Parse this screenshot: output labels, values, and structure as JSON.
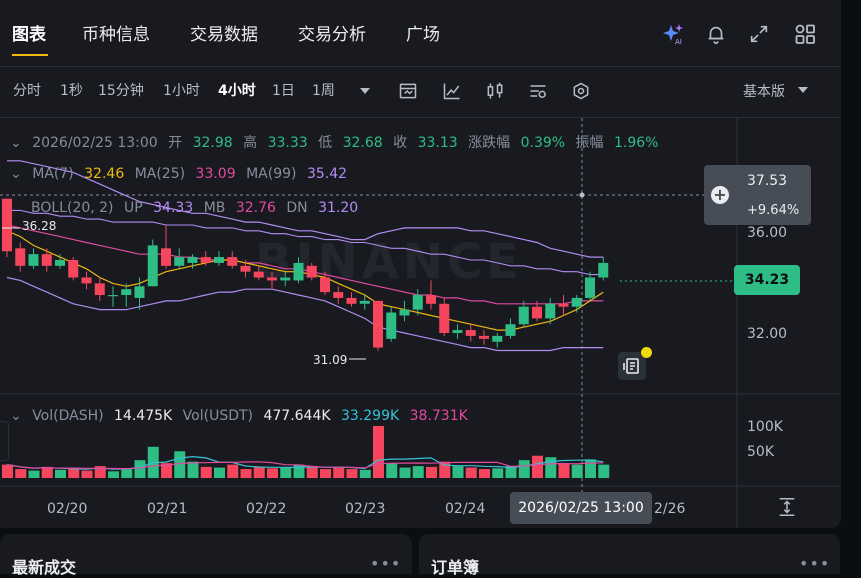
{
  "tabs": [
    {
      "label": "图表",
      "active": true
    },
    {
      "label": "币种信息"
    },
    {
      "label": "交易数据"
    },
    {
      "label": "交易分析"
    },
    {
      "label": "广场"
    }
  ],
  "top_icons": [
    "ai-sparkle-icon",
    "bell-icon",
    "expand-icon",
    "grid-icon"
  ],
  "intervals": [
    {
      "label": "分时"
    },
    {
      "label": "1秒"
    },
    {
      "label": "15分钟"
    },
    {
      "label": "1小时"
    },
    {
      "label": "4小时",
      "active": true
    },
    {
      "label": "1日"
    },
    {
      "label": "1周"
    }
  ],
  "toolbar_icons": [
    "caret-down-icon",
    "indicator-icon",
    "line-tool-icon",
    "candle-type-icon",
    "settings-icon",
    "depth-icon"
  ],
  "version_label": "基本版",
  "ohlc": {
    "date": "2026/02/25 13:00",
    "open_label": "开",
    "open": "32.98",
    "high_label": "高",
    "high": "33.33",
    "low_label": "低",
    "low": "32.68",
    "close_label": "收",
    "close": "33.13",
    "change_label": "涨跌幅",
    "change": "0.39%",
    "amp_label": "振幅",
    "amp": "1.96%"
  },
  "ma": {
    "ma7_label": "MA(7)",
    "ma7": "32.46",
    "ma25_label": "MA(25)",
    "ma25": "33.09",
    "ma99_label": "MA(99)",
    "ma99": "35.42"
  },
  "boll": {
    "label": "BOLL(20, 2)",
    "up_label": "UP",
    "up": "34.33",
    "mb_label": "MB",
    "mb": "32.76",
    "dn_label": "DN",
    "dn": "31.20"
  },
  "volume": {
    "label1": "Vol(DASH)",
    "v1": "14.475K",
    "label2": "Vol(USDT)",
    "v2": "477.644K",
    "ma1": "33.299K",
    "ma2": "38.731K"
  },
  "crosshair": {
    "price": "37.53",
    "change": "+9.64%",
    "time": "2026/02/25 13:00"
  },
  "last_price": "34.23",
  "price_axis": [
    "36.00",
    "32.00"
  ],
  "volume_axis": [
    "100K",
    "50K"
  ],
  "x_axis": [
    "02/20",
    "02/21",
    "02/22",
    "02/23",
    "02/24",
    "2/26"
  ],
  "annotations": {
    "high": "36.28",
    "low": "31.09"
  },
  "watermark": "BINANCE",
  "bottom_cards": [
    {
      "title": "最新成交"
    },
    {
      "title": "订单簿"
    }
  ],
  "colors": {
    "up": "#2ebd85",
    "down": "#f6465d",
    "ma7": "#f0b90b",
    "ma25": "#e04aa0",
    "ma99": "#b18cf2",
    "accent": "#f0b90b"
  },
  "chart_data": {
    "type": "candlestick",
    "price_range": [
      30.5,
      37.9
    ],
    "candles": [
      {
        "o": 36.3,
        "c": 34.5,
        "h": 36.3,
        "l": 34.3
      },
      {
        "o": 34.6,
        "c": 34.0,
        "h": 34.8,
        "l": 33.8
      },
      {
        "o": 34.0,
        "c": 34.4,
        "h": 34.6,
        "l": 33.9
      },
      {
        "o": 34.4,
        "c": 34.0,
        "h": 34.6,
        "l": 33.8
      },
      {
        "o": 34.0,
        "c": 34.2,
        "h": 34.4,
        "l": 33.9
      },
      {
        "o": 34.2,
        "c": 33.6,
        "h": 34.3,
        "l": 33.5
      },
      {
        "o": 33.6,
        "c": 33.4,
        "h": 33.8,
        "l": 33.2
      },
      {
        "o": 33.4,
        "c": 33.0,
        "h": 33.6,
        "l": 32.8
      },
      {
        "o": 33.0,
        "c": 33.0,
        "h": 33.3,
        "l": 32.6
      },
      {
        "o": 33.0,
        "c": 33.2,
        "h": 33.4,
        "l": 32.6
      },
      {
        "o": 32.9,
        "c": 33.3,
        "h": 33.6,
        "l": 32.5
      },
      {
        "o": 33.3,
        "c": 34.7,
        "h": 34.9,
        "l": 33.3
      },
      {
        "o": 34.6,
        "c": 34.0,
        "h": 35.4,
        "l": 33.9
      },
      {
        "o": 34.0,
        "c": 34.3,
        "h": 34.6,
        "l": 33.9
      },
      {
        "o": 34.1,
        "c": 34.3,
        "h": 34.4,
        "l": 33.9
      },
      {
        "o": 34.3,
        "c": 34.1,
        "h": 34.5,
        "l": 34.0
      },
      {
        "o": 34.1,
        "c": 34.3,
        "h": 34.5,
        "l": 34.0
      },
      {
        "o": 34.3,
        "c": 34.0,
        "h": 34.5,
        "l": 33.9
      },
      {
        "o": 34.0,
        "c": 33.8,
        "h": 34.2,
        "l": 33.6
      },
      {
        "o": 33.8,
        "c": 33.6,
        "h": 34.0,
        "l": 33.5
      },
      {
        "o": 33.6,
        "c": 33.5,
        "h": 33.8,
        "l": 33.2
      },
      {
        "o": 33.5,
        "c": 33.6,
        "h": 33.8,
        "l": 33.3
      },
      {
        "o": 33.5,
        "c": 34.1,
        "h": 34.3,
        "l": 33.4
      },
      {
        "o": 34.0,
        "c": 33.6,
        "h": 34.1,
        "l": 33.5
      },
      {
        "o": 33.6,
        "c": 33.1,
        "h": 33.8,
        "l": 33.0
      },
      {
        "o": 33.1,
        "c": 32.9,
        "h": 33.3,
        "l": 32.7
      },
      {
        "o": 32.9,
        "c": 32.7,
        "h": 33.1,
        "l": 32.6
      },
      {
        "o": 32.7,
        "c": 32.8,
        "h": 33.0,
        "l": 32.5
      },
      {
        "o": 32.8,
        "c": 31.2,
        "h": 32.8,
        "l": 31.1
      },
      {
        "o": 31.5,
        "c": 32.4,
        "h": 32.6,
        "l": 31.4
      },
      {
        "o": 32.3,
        "c": 32.5,
        "h": 32.8,
        "l": 32.1
      },
      {
        "o": 32.5,
        "c": 33.0,
        "h": 33.2,
        "l": 32.3
      },
      {
        "o": 33.0,
        "c": 32.7,
        "h": 33.5,
        "l": 32.5
      },
      {
        "o": 32.7,
        "c": 31.7,
        "h": 32.9,
        "l": 31.6
      },
      {
        "o": 31.7,
        "c": 31.8,
        "h": 32.0,
        "l": 31.5
      },
      {
        "o": 31.8,
        "c": 31.6,
        "h": 32.0,
        "l": 31.4
      },
      {
        "o": 31.6,
        "c": 31.5,
        "h": 31.8,
        "l": 31.3
      },
      {
        "o": 31.4,
        "c": 31.6,
        "h": 31.7,
        "l": 31.2
      },
      {
        "o": 31.6,
        "c": 32.0,
        "h": 32.2,
        "l": 31.5
      },
      {
        "o": 32.0,
        "c": 32.6,
        "h": 32.8,
        "l": 31.9
      },
      {
        "o": 32.6,
        "c": 32.2,
        "h": 32.8,
        "l": 32.1
      },
      {
        "o": 32.2,
        "c": 32.7,
        "h": 32.9,
        "l": 32.0
      },
      {
        "o": 32.7,
        "c": 32.6,
        "h": 33.0,
        "l": 32.3
      },
      {
        "o": 32.6,
        "c": 32.9,
        "h": 33.0,
        "l": 32.4
      },
      {
        "o": 32.9,
        "c": 33.6,
        "h": 33.8,
        "l": 32.8
      },
      {
        "o": 33.6,
        "c": 34.1,
        "h": 34.3,
        "l": 33.5
      }
    ],
    "volumes": [
      18,
      12,
      10,
      15,
      11,
      14,
      10,
      16,
      9,
      12,
      24,
      42,
      20,
      36,
      22,
      15,
      14,
      18,
      12,
      15,
      13,
      14,
      18,
      15,
      12,
      14,
      12,
      11,
      70,
      20,
      14,
      16,
      15,
      22,
      16,
      14,
      12,
      13,
      16,
      24,
      30,
      28,
      20,
      18,
      25,
      18
    ],
    "ma7": [
      35.2,
      35.0,
      34.7,
      34.5,
      34.3,
      34.1,
      33.9,
      33.6,
      33.4,
      33.3,
      33.4,
      33.6,
      33.8,
      33.9,
      34.0,
      34.1,
      34.2,
      34.2,
      34.1,
      34.0,
      33.9,
      33.8,
      33.8,
      33.7,
      33.6,
      33.4,
      33.2,
      33.0,
      32.7,
      32.6,
      32.5,
      32.4,
      32.3,
      32.2,
      32.1,
      32.0,
      31.9,
      31.8,
      31.8,
      31.9,
      32.0,
      32.1,
      32.3,
      32.5,
      32.8,
      33.1
    ],
    "ma25": [
      35.4,
      35.3,
      35.2,
      35.1,
      35.0,
      34.9,
      34.8,
      34.7,
      34.6,
      34.5,
      34.4,
      34.4,
      34.4,
      34.3,
      34.3,
      34.2,
      34.2,
      34.2,
      34.1,
      34.1,
      34.0,
      33.9,
      33.9,
      33.8,
      33.7,
      33.6,
      33.5,
      33.4,
      33.3,
      33.2,
      33.1,
      33.0,
      33.0,
      32.9,
      32.9,
      32.8,
      32.8,
      32.7,
      32.7,
      32.7,
      32.7,
      32.7,
      32.7,
      32.8,
      32.8,
      32.8
    ],
    "ma99": [
      35.9,
      35.9,
      35.8,
      35.8,
      35.7,
      35.7,
      35.6,
      35.6,
      35.5,
      35.5,
      35.5,
      35.5,
      35.4,
      35.4,
      35.4,
      35.3,
      35.3,
      35.3,
      35.2,
      35.2,
      35.1,
      35.1,
      35.0,
      35.0,
      34.9,
      34.9,
      34.8,
      34.8,
      34.7,
      34.6,
      34.6,
      34.5,
      34.4,
      34.4,
      34.3,
      34.2,
      34.2,
      34.1,
      34.0,
      34.0,
      33.9,
      33.9,
      33.8,
      33.8,
      33.7,
      33.7
    ],
    "boll_up": [
      37.6,
      37.6,
      37.5,
      37.4,
      37.3,
      37.2,
      37.0,
      36.8,
      36.6,
      36.4,
      36.2,
      36.1,
      36.0,
      35.9,
      35.8,
      35.8,
      35.7,
      35.6,
      35.5,
      35.5,
      35.4,
      35.3,
      35.2,
      35.2,
      35.1,
      35.0,
      34.9,
      34.9,
      35.1,
      35.2,
      35.3,
      35.3,
      35.3,
      35.3,
      35.3,
      35.2,
      35.2,
      35.1,
      35.0,
      34.9,
      34.8,
      34.6,
      34.5,
      34.4,
      34.3,
      34.3
    ],
    "boll_dn": [
      33.6,
      33.5,
      33.3,
      33.1,
      32.9,
      32.7,
      32.6,
      32.5,
      32.5,
      32.5,
      32.6,
      32.7,
      32.8,
      32.8,
      32.9,
      33.0,
      33.1,
      33.1,
      33.2,
      33.2,
      33.2,
      33.1,
      33.0,
      32.9,
      32.8,
      32.6,
      32.4,
      32.2,
      31.9,
      31.8,
      31.7,
      31.6,
      31.5,
      31.4,
      31.3,
      31.2,
      31.2,
      31.1,
      31.1,
      31.1,
      31.1,
      31.1,
      31.2,
      31.2,
      31.2,
      31.2
    ]
  }
}
